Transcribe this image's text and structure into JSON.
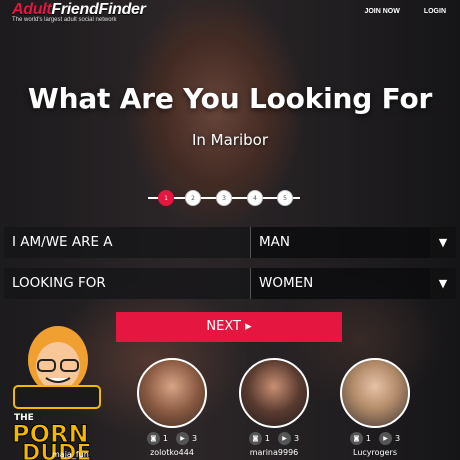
{
  "header": {
    "logo_brand_a": "Adult",
    "logo_brand_b": "FriendFinder",
    "logo_tagline": "The world's largest adult social network",
    "join_label": "JOIN NOW",
    "login_label": "LOGIN"
  },
  "hero": {
    "title": "What Are You Looking For",
    "subtitle": "In Maribor"
  },
  "steps": [
    "1",
    "2",
    "3",
    "4",
    "5"
  ],
  "form": {
    "iam_label": "I AM/WE ARE A",
    "iam_value": "MAN",
    "looking_label": "LOOKING FOR",
    "looking_value": "WOMEN",
    "caret": "▼",
    "next_label": "NEXT ▸"
  },
  "badge": {
    "line1": "THE",
    "line2": "PORN",
    "line3": "DUDE"
  },
  "profiles": [
    {
      "name": "zolotko444",
      "photos": "1",
      "videos": "3"
    },
    {
      "name": "marina9996",
      "photos": "1",
      "videos": "3"
    },
    {
      "name": "Lucyrogers",
      "photos": "1",
      "videos": "3"
    }
  ],
  "partial_name": "maja_fun",
  "colors": {
    "accent": "#e5163f",
    "badge_yellow": "#f5b800"
  }
}
